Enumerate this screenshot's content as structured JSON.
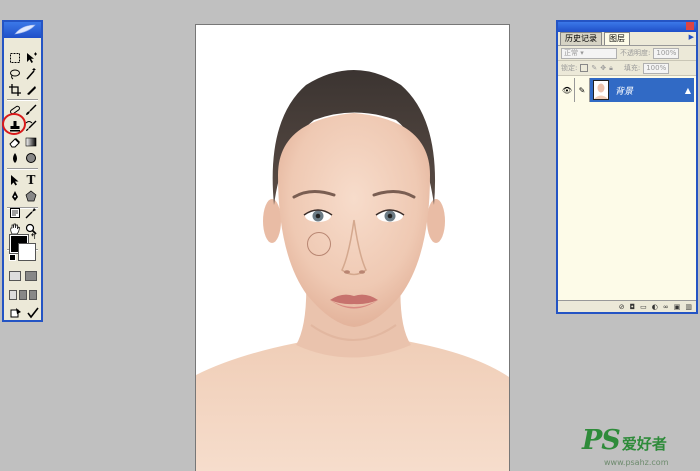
{
  "layers_panel": {
    "tabs": [
      "历史记录",
      "图层"
    ],
    "blend_mode": "正常",
    "opacity_label": "不透明度:",
    "opacity_value": "100%",
    "lock_label": "锁定:",
    "fill_label": "填充:",
    "fill_value": "100%",
    "layer_name": "背景"
  },
  "watermark": {
    "logo": "PS",
    "chinese": "爱好者",
    "url": "www.psahz.com"
  },
  "toolbox": {
    "tools": [
      "marquee-icon",
      "move-icon",
      "lasso-icon",
      "magic-wand-icon",
      "crop-icon",
      "slice-icon",
      "healing-icon",
      "brush-icon",
      "clone-stamp-icon",
      "history-brush-icon",
      "eraser-icon",
      "gradient-icon",
      "blur-icon",
      "dodge-icon",
      "path-select-icon",
      "type-icon",
      "pen-icon",
      "shape-icon",
      "notes-icon",
      "eyedropper-icon",
      "hand-icon",
      "zoom-icon"
    ],
    "highlighted_tool": "clone-stamp-icon",
    "foreground_color": "#000000",
    "background_color": "#ffffff"
  }
}
